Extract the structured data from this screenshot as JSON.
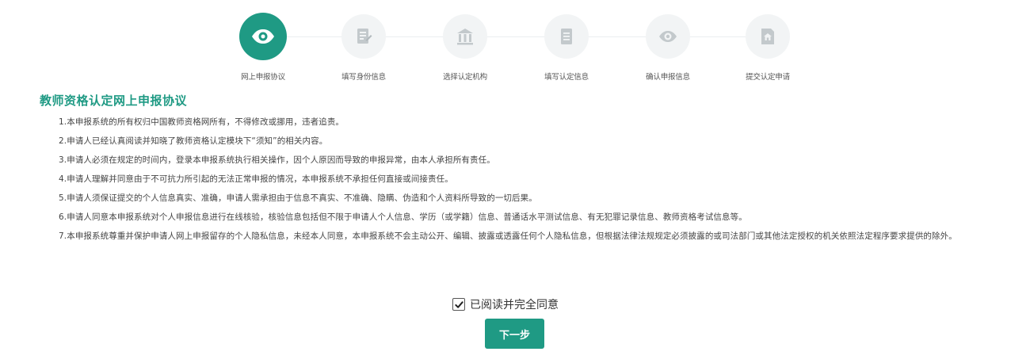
{
  "colors": {
    "accent": "#1f9a84",
    "inactive_circle": "#f2f4f5",
    "inactive_icon": "#c3c9cc"
  },
  "steps": [
    {
      "label": "网上申报协议",
      "icon": "eye-icon",
      "active": true
    },
    {
      "label": "填写身份信息",
      "icon": "document-icon",
      "active": false
    },
    {
      "label": "选择认定机构",
      "icon": "institution-icon",
      "active": false
    },
    {
      "label": "填写认定信息",
      "icon": "form-icon",
      "active": false
    },
    {
      "label": "确认申报信息",
      "icon": "eye-icon",
      "active": false
    },
    {
      "label": "提交认定申请",
      "icon": "house-icon",
      "active": false
    }
  ],
  "agreement": {
    "title": "教师资格认定网上申报协议",
    "clauses": [
      "1.本申报系统的所有权归中国教师资格网所有，不得修改或挪用，违者追责。",
      "2.申请人已经认真阅读并知晓了教师资格认定模块下“须知”的相关内容。",
      "3.申请人必须在规定的时间内，登录本申报系统执行相关操作，因个人原因而导致的申报异常，由本人承担所有责任。",
      "4.申请人理解并同意由于不可抗力所引起的无法正常申报的情况，本申报系统不承担任何直接或间接责任。",
      "5.申请人须保证提交的个人信息真实、准确，申请人需承担由于信息不真实、不准确、隐瞒、伪造和个人资料所导致的一切后果。",
      "6.申请人同意本申报系统对个人申报信息进行在线核验，核验信息包括但不限于申请人个人信息、学历（或学籍）信息、普通话水平测试信息、有无犯罪记录信息、教师资格考试信息等。",
      "7.本申报系统尊重并保护申请人网上申报留存的个人隐私信息，未经本人同意，本申报系统不会主动公开、编辑、披露或透露任何个人隐私信息，但根据法律法规规定必须披露的或司法部门或其他法定授权的机关依照法定程序要求提供的除外。"
    ]
  },
  "consent": {
    "checked": true,
    "label": "已阅读并完全同意"
  },
  "next_button": {
    "label": "下一步"
  }
}
